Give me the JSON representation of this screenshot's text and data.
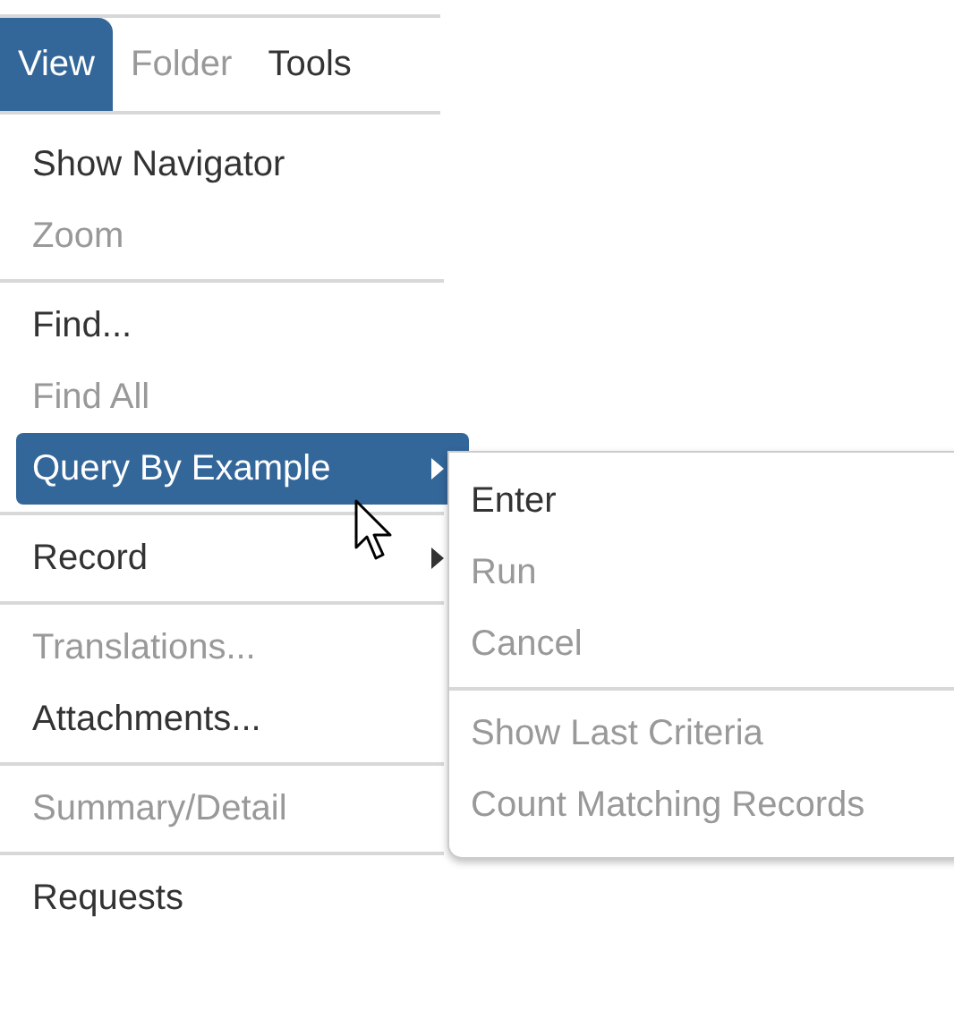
{
  "menubar": [
    {
      "label": "View",
      "selected": true,
      "disabled": false
    },
    {
      "label": "Folder",
      "selected": false,
      "disabled": true
    },
    {
      "label": "Tools",
      "selected": false,
      "disabled": false
    }
  ],
  "menu": [
    {
      "kind": "item",
      "label": "Show Navigator",
      "disabled": false,
      "selected": false
    },
    {
      "kind": "item",
      "label": "Zoom",
      "disabled": true,
      "selected": false
    },
    {
      "kind": "separator"
    },
    {
      "kind": "item",
      "label": "Find...",
      "disabled": false,
      "selected": false
    },
    {
      "kind": "item",
      "label": "Find All",
      "disabled": true,
      "selected": false
    },
    {
      "kind": "submenu",
      "label": "Query By Example",
      "disabled": false,
      "selected": true
    },
    {
      "kind": "separator"
    },
    {
      "kind": "submenu",
      "label": "Record",
      "disabled": false,
      "selected": false
    },
    {
      "kind": "separator"
    },
    {
      "kind": "item",
      "label": "Translations...",
      "disabled": true,
      "selected": false
    },
    {
      "kind": "item",
      "label": "Attachments...",
      "disabled": false,
      "selected": false
    },
    {
      "kind": "separator"
    },
    {
      "kind": "item",
      "label": "Summary/Detail",
      "disabled": true,
      "selected": false
    },
    {
      "kind": "separator"
    },
    {
      "kind": "item",
      "label": "Requests",
      "disabled": false,
      "selected": false
    }
  ],
  "submenu": [
    {
      "kind": "item",
      "label": "Enter",
      "disabled": false
    },
    {
      "kind": "item",
      "label": "Run",
      "disabled": true
    },
    {
      "kind": "item",
      "label": "Cancel",
      "disabled": true
    },
    {
      "kind": "separator"
    },
    {
      "kind": "item",
      "label": "Show Last Criteria",
      "disabled": true
    },
    {
      "kind": "item",
      "label": "Count Matching Records",
      "disabled": true
    }
  ]
}
